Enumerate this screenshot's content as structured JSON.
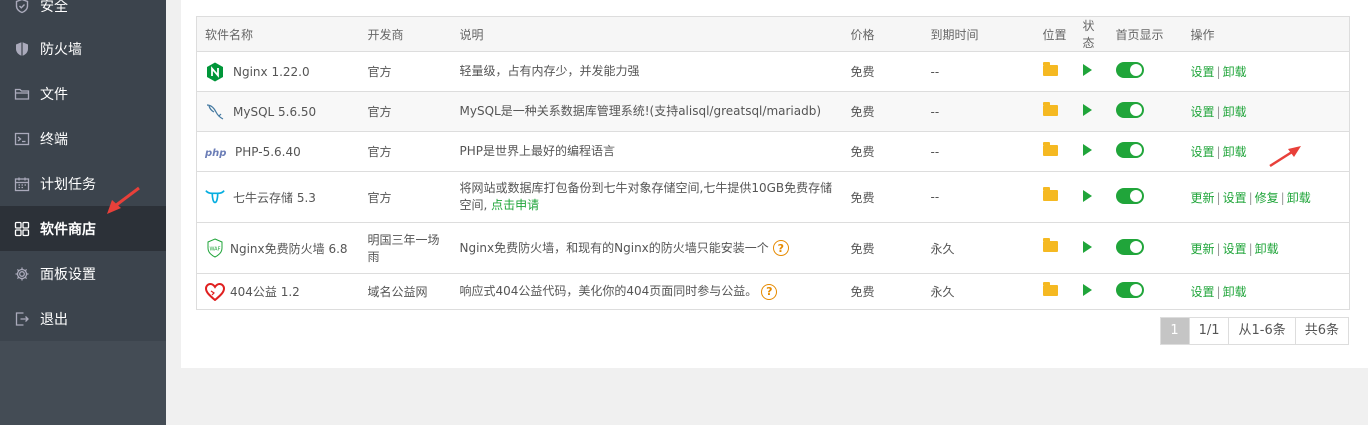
{
  "sidebar": {
    "items": [
      {
        "label": "安全",
        "icon": "shield-check-icon"
      },
      {
        "label": "防火墙",
        "icon": "firewall-shield-icon"
      },
      {
        "label": "文件",
        "icon": "folder-icon"
      },
      {
        "label": "终端",
        "icon": "terminal-icon"
      },
      {
        "label": "计划任务",
        "icon": "calendar-icon"
      },
      {
        "label": "软件商店",
        "icon": "grid-icon",
        "active": true
      },
      {
        "label": "面板设置",
        "icon": "gear-icon"
      },
      {
        "label": "退出",
        "icon": "logout-icon"
      }
    ]
  },
  "table": {
    "headers": {
      "name": "软件名称",
      "developer": "开发商",
      "desc": "说明",
      "price": "价格",
      "expire": "到期时间",
      "location": "位置",
      "status": "状态",
      "homepage": "首页显示",
      "ops": "操作"
    },
    "rows": [
      {
        "name": "Nginx 1.22.0",
        "icon": "nginx-icon",
        "developer": "官方",
        "desc": "轻量级，占有内存少，并发能力强",
        "price": "免费",
        "expire": "--",
        "ops": [
          "设置",
          "卸载"
        ]
      },
      {
        "name": "MySQL 5.6.50",
        "icon": "mysql-dolphin-icon",
        "developer": "官方",
        "desc": "MySQL是一种关系数据库管理系统!(支持alisql/greatsql/mariadb)",
        "price": "免费",
        "expire": "--",
        "ops": [
          "设置",
          "卸载"
        ]
      },
      {
        "name": "PHP-5.6.40",
        "icon": "php-icon",
        "developer": "官方",
        "desc": "PHP是世界上最好的编程语言",
        "price": "免费",
        "expire": "--",
        "ops": [
          "设置",
          "卸载"
        ]
      },
      {
        "name": "七牛云存储 5.3",
        "icon": "qiniu-icon",
        "developer": "官方",
        "desc": "将网站或数据库打包备份到七牛对象存储空间,七牛提供10GB免费存储空间,",
        "desc_link": "点击申请",
        "price": "免费",
        "expire": "--",
        "ops": [
          "更新",
          "设置",
          "修复",
          "卸载"
        ]
      },
      {
        "name": "Nginx免费防火墙 6.8",
        "icon": "waf-icon",
        "developer": "明国三年一场雨",
        "desc": "Nginx免费防火墙，和现有的Nginx的防火墙只能安装一个",
        "help": "?",
        "price": "免费",
        "expire": "永久",
        "ops": [
          "更新",
          "设置",
          "卸载"
        ]
      },
      {
        "name": "404公益 1.2",
        "icon": "heart-404-icon",
        "developer": "域名公益网",
        "desc": "响应式404公益代码，美化你的404页面同时参与公益。",
        "help": "?",
        "price": "免费",
        "expire": "永久",
        "ops": [
          "设置",
          "卸载"
        ]
      }
    ]
  },
  "pager": {
    "current": "1",
    "pages": "1/1",
    "range": "从1-6条",
    "total": "共6条"
  },
  "colors": {
    "accent": "#20a53a",
    "sidebar": "#3c444d",
    "annotation": "#e8403a"
  }
}
